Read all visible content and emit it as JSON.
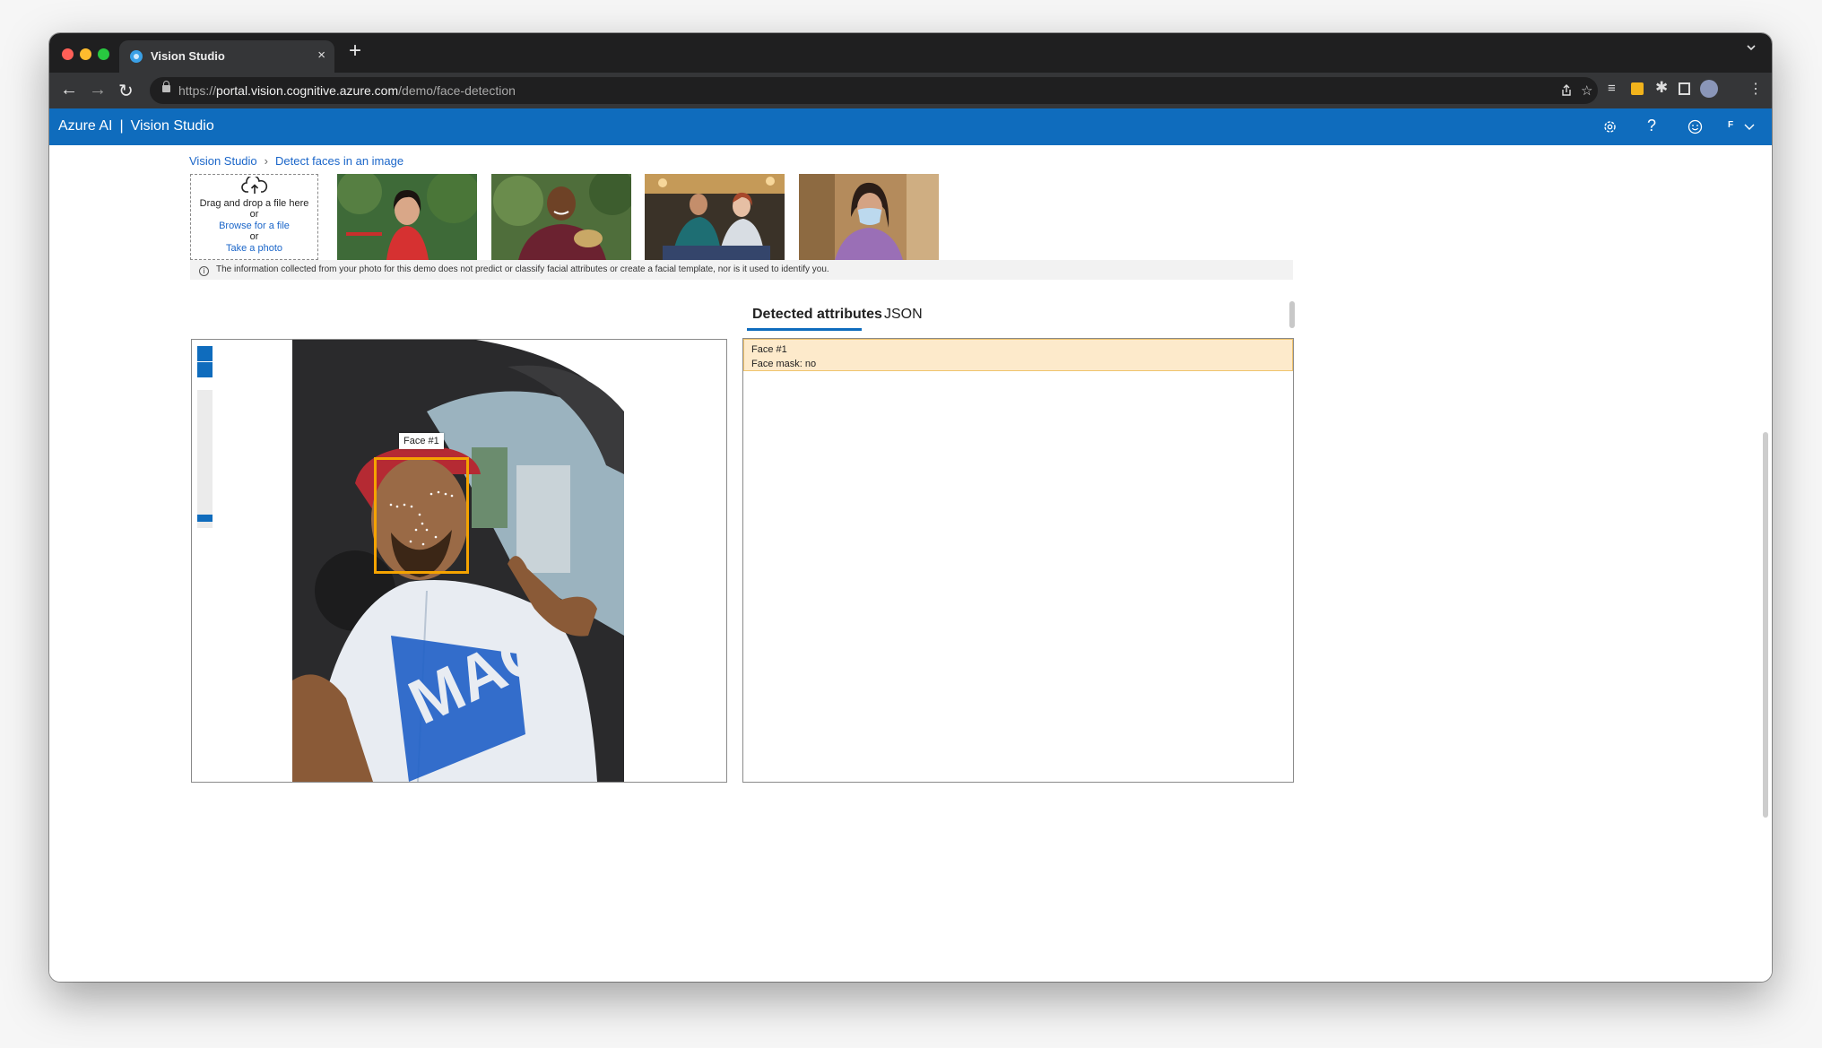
{
  "browser": {
    "tab_title": "Vision Studio",
    "tab_close": "×",
    "new_tab": "+",
    "url_prefix": "https://",
    "url_host": "portal.vision.cognitive.azure.com",
    "url_path": "/demo/face-detection",
    "back": "←",
    "forward": "→",
    "reload": "↻"
  },
  "app": {
    "brand": "Azure AI",
    "separator": "|",
    "product": "Vision Studio",
    "user_initial": "F",
    "icons": [
      "gear-icon",
      "help-icon",
      "feedback-smiley-icon",
      "chevron-down-icon"
    ]
  },
  "breadcrumb": {
    "home": "Vision Studio",
    "current": "Detect faces in an image"
  },
  "upload": {
    "drag_text": "Drag and drop a file here",
    "or1": "or",
    "browse": "Browse for a file",
    "or2": "or",
    "photo": "Take a photo"
  },
  "notice": "The information collected from your photo for this demo does not predict or classify facial attributes or create a facial template, nor is it used to identify you.",
  "result_tabs": {
    "attributes": "Detected attributes",
    "json": "JSON"
  },
  "viewer": {
    "face_label": "Face #1"
  },
  "detected": {
    "face": "Face #1",
    "mask": "Face mask: no"
  },
  "colors": {
    "azure_blue": "#0f6cbd",
    "face_box": "#f5a300",
    "highlight": "#fdeacb"
  }
}
